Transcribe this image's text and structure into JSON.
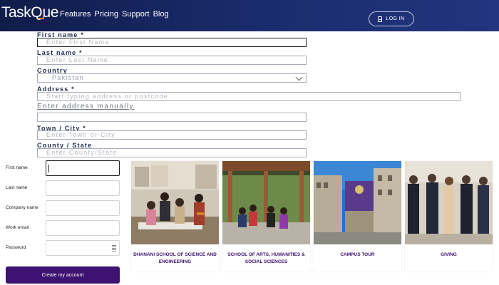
{
  "nav": {
    "logo_prefix": "Task",
    "logo_suffix": "ue",
    "logo_q": "Q",
    "links": [
      "Features",
      "Pricing",
      "Support",
      "Blog"
    ],
    "login_label": "LOG IN"
  },
  "address_form": {
    "first_name_label": "First name *",
    "first_name_placeholder": "Enter First Name",
    "last_name_label": "Last name *",
    "last_name_placeholder": "Enter Last Name",
    "country_label": "Country",
    "country_value": "Pakistan",
    "address_label": "Address *",
    "address_placeholder": "Start typing address or postcode",
    "manual_link": "Enter address manually",
    "town_label": "Town / City *",
    "town_placeholder": "Enter Town or City",
    "county_label": "County / State",
    "county_placeholder": "Enter County/State"
  },
  "signup": {
    "first_name_label": "First name",
    "last_name_label": "Last name",
    "company_label": "Company name",
    "email_label": "Work email",
    "password_label": "Password",
    "create_button": "Create my account"
  },
  "cards": [
    {
      "caption": "DHANANI SCHOOL OF SCIENCE AND ENGINEERING"
    },
    {
      "caption": "SCHOOL OF ARTS, HUMANITIES & SOCIAL SCIENCES"
    },
    {
      "caption": "CAMPUS TOUR"
    },
    {
      "caption": "GIVING"
    }
  ],
  "colors": {
    "nav_bg": "#1b2c6e",
    "logo_accent": "#ff7a1a",
    "primary_button": "#3d1270",
    "card_caption": "#3d1270"
  }
}
